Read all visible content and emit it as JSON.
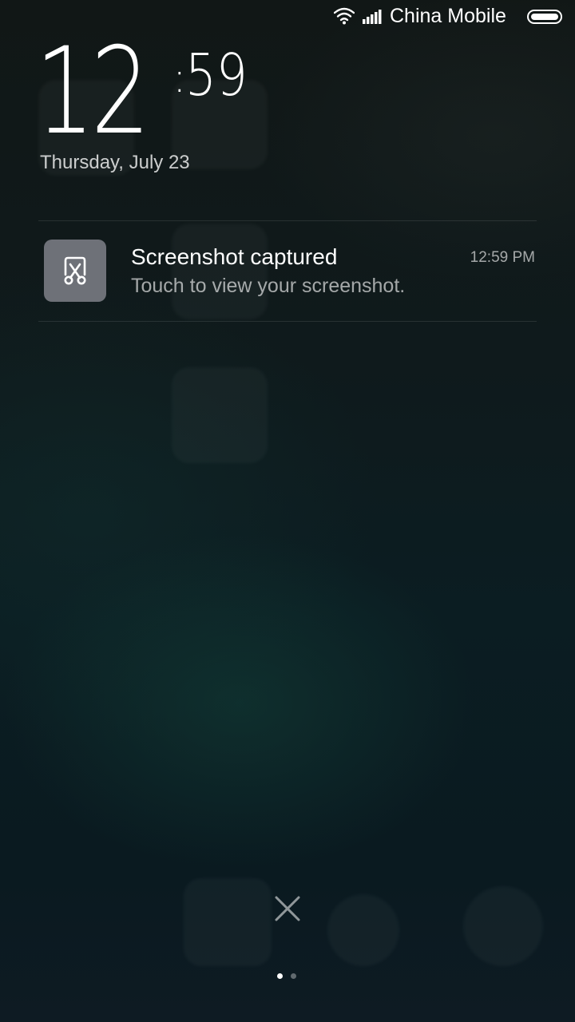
{
  "status_bar": {
    "carrier": "China Mobile",
    "icons": [
      "wifi-icon",
      "signal-icon",
      "battery-icon"
    ]
  },
  "lock_clock": {
    "hours": "12",
    "separator": ":",
    "minutes": "59",
    "date": "Thursday, July 23"
  },
  "notification": {
    "app_icon": "screenshot-scissors-icon",
    "title": "Screenshot captured",
    "body": "Touch to view your screenshot.",
    "time": "12:59 PM",
    "icon_bg_color": "#6e7178"
  },
  "controls": {
    "clear_icon": "close-icon"
  },
  "pager": {
    "total_pages": 2,
    "active_page": 1
  },
  "colors": {
    "text_primary": "#ffffff",
    "text_secondary": "#a8acad"
  }
}
